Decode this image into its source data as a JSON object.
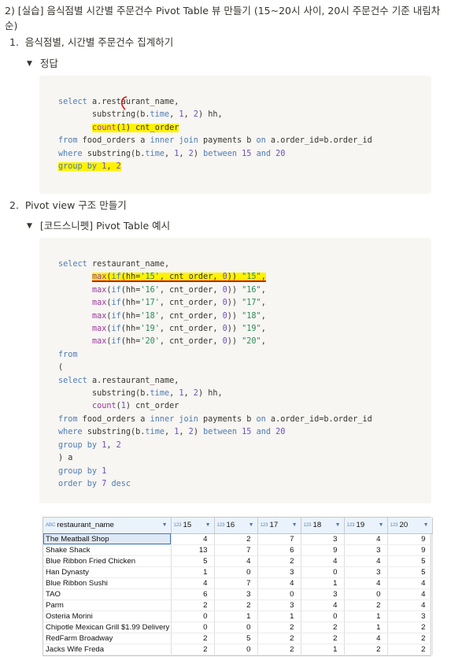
{
  "page_title": "2) [실습] 음식점별 시간별 주문건수 Pivot Table 뷰 만들기 (15~20시 사이, 20시 주문건수 기준 내림차순)",
  "section1": {
    "number": "1.",
    "title": "음식점별, 시간별 주문건수 집계하기"
  },
  "toggle1": {
    "label": "정답"
  },
  "section2": {
    "number": "2.",
    "title": "Pivot view 구조 만들기"
  },
  "toggle2": {
    "label": "[코드스니펫] Pivot Table 예시"
  },
  "code1": {
    "l1_kw": "select",
    "l1_rest": " a.restaurant_name,",
    "l2_pre": "       ",
    "l2_fn": "substring",
    "l2_a": "(b.",
    "l2_kw": "time",
    "l2_b": ", ",
    "l2_n1": "1",
    "l2_c": ", ",
    "l2_n2": "2",
    "l2_d": ") hh,",
    "l3_pre": "       ",
    "l3_fn": "count",
    "l3_a": "(",
    "l3_n": "1",
    "l3_b": ") cnt_order",
    "l4_kw": "from",
    "l4_a": " food_orders a ",
    "l4_kw2": "inner join",
    "l4_b": " payments b ",
    "l4_kw3": "on",
    "l4_c": " a.order_id=b.order_id",
    "l5_kw": "where",
    "l5_a": " ",
    "l5_fn": "substring",
    "l5_b": "(b.",
    "l5_kw2": "time",
    "l5_c": ", ",
    "l5_n1": "1",
    "l5_d": ", ",
    "l5_n2": "2",
    "l5_e": ") ",
    "l5_kw3": "between",
    "l5_f": " ",
    "l5_n3": "15",
    "l5_g": " ",
    "l5_kw4": "and",
    "l5_h": " ",
    "l5_n4": "20",
    "l6_kw": "group by",
    "l6_a": " ",
    "l6_n1": "1",
    "l6_b": ", ",
    "l6_n2": "2"
  },
  "code2": {
    "select_kw": "select",
    "select_rest": " restaurant_name,",
    "max_lines": [
      {
        "hh": "'15'",
        "alias": "\"15\""
      },
      {
        "hh": "'16'",
        "alias": "\"16\""
      },
      {
        "hh": "'17'",
        "alias": "\"17\""
      },
      {
        "hh": "'18'",
        "alias": "\"18\""
      },
      {
        "hh": "'19'",
        "alias": "\"19\""
      },
      {
        "hh": "'20'",
        "alias": "\"20\""
      }
    ],
    "max_fn": "max",
    "if_fn": "if",
    "hh_eq": "hh=",
    "cnt": ", cnt_order, ",
    "zero": "0",
    "from_kw": "from",
    "paren_open": "(",
    "inner_select_kw": "select",
    "inner_select_rest": " a.restaurant_name,",
    "inner_sub_fn": "substring",
    "inner_sub_a": "(b.",
    "inner_sub_time": "time",
    "inner_sub_rest": ") hh,",
    "inner_count_fn": "count",
    "inner_count_rest": ") cnt_order",
    "inner_from_kw": "from",
    "inner_from_a": " food_orders a ",
    "inner_from_kw2": "inner join",
    "inner_from_b": " payments b ",
    "inner_from_kw3": "on",
    "inner_from_c": " a.order_id=b.order_id",
    "inner_where_kw": "where",
    "inner_where_fn": "substring",
    "inner_where_time": "time",
    "between_kw": "between",
    "and_kw": "and",
    "n15": "15",
    "n20": "20",
    "inner_group_kw": "group by",
    "close": ") a",
    "group_kw": "group by",
    "group_n": "1",
    "order_kw": "order by",
    "order_n": "7",
    "desc_kw": "desc",
    "n1": "1",
    "n2": "2"
  },
  "grid": {
    "badge_text": "ABC",
    "badge_num": "123",
    "columns": [
      "restaurant_name",
      "15",
      "16",
      "17",
      "18",
      "19",
      "20"
    ],
    "rows": [
      [
        "The Meatball Shop",
        "4",
        "2",
        "7",
        "3",
        "4",
        "9"
      ],
      [
        "Shake Shack",
        "13",
        "7",
        "6",
        "9",
        "3",
        "9"
      ],
      [
        "Blue Ribbon Fried Chicken",
        "5",
        "4",
        "2",
        "4",
        "4",
        "5"
      ],
      [
        "Han Dynasty",
        "1",
        "0",
        "3",
        "0",
        "3",
        "5"
      ],
      [
        "Blue Ribbon Sushi",
        "4",
        "7",
        "4",
        "1",
        "4",
        "4"
      ],
      [
        "TAO",
        "6",
        "3",
        "0",
        "3",
        "0",
        "4"
      ],
      [
        "Parm",
        "2",
        "2",
        "3",
        "4",
        "2",
        "4"
      ],
      [
        "Osteria Morini",
        "0",
        "1",
        "1",
        "0",
        "1",
        "3"
      ],
      [
        "Chipotle Mexican Grill $1.99 Delivery",
        "0",
        "0",
        "2",
        "2",
        "1",
        "2"
      ],
      [
        "RedFarm Broadway",
        "2",
        "5",
        "2",
        "2",
        "4",
        "2"
      ],
      [
        "Jacks Wife Freda",
        "2",
        "0",
        "2",
        "1",
        "2",
        "2"
      ]
    ]
  }
}
